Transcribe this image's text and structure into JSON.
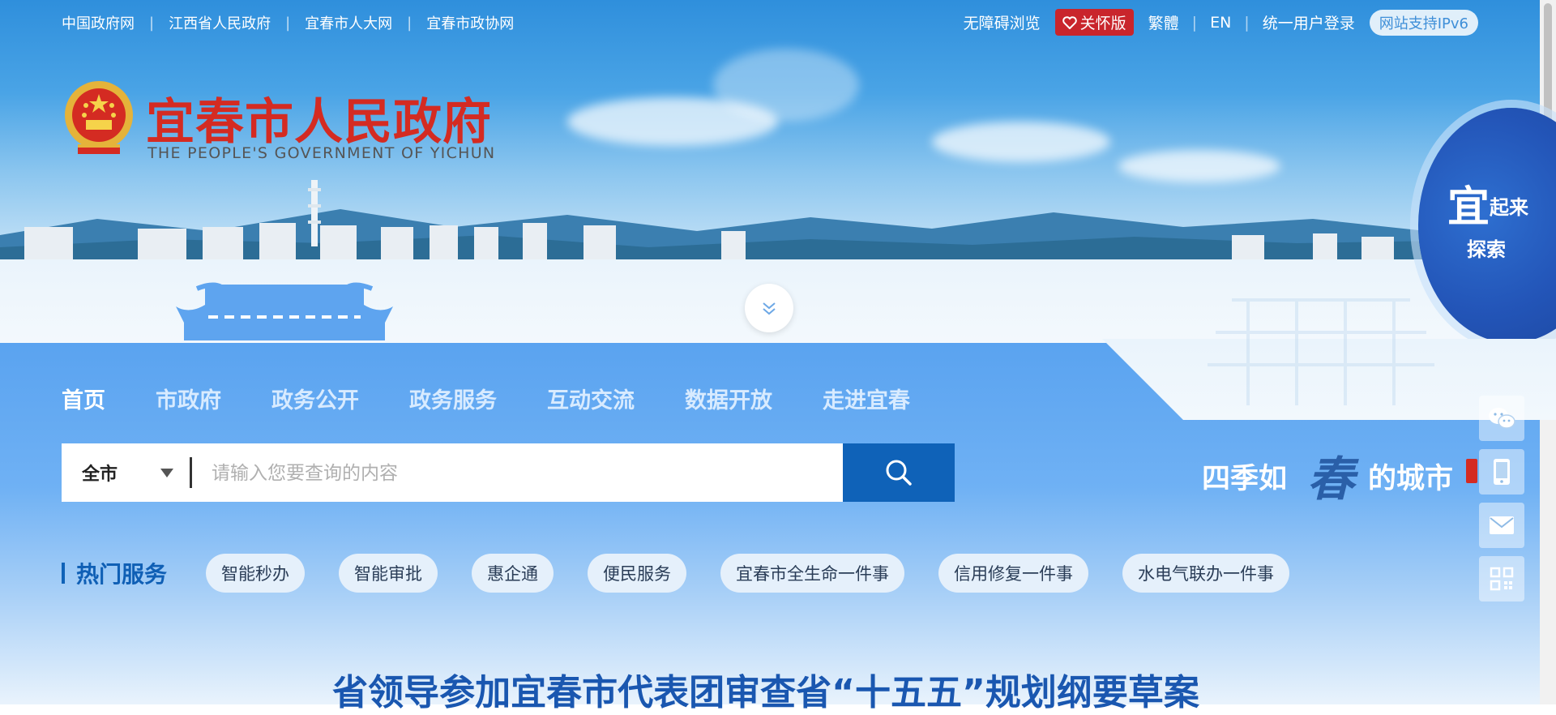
{
  "top_links": [
    "中国政府网",
    "江西省人民政府",
    "宜春市人大网",
    "宜春市政协网"
  ],
  "top_right": {
    "accessibility": "无障碍浏览",
    "care_mode": "关怀版",
    "traditional": "繁體",
    "english": "EN",
    "login": "统一用户登录",
    "ipv6": "网站支持IPv6"
  },
  "logo": {
    "title_cn": "宜春市人民政府",
    "title_en": "THE PEOPLE'S GOVERNMENT OF YICHUN"
  },
  "explore_badge": {
    "big": "宜",
    "small": "起来",
    "bottom": "探索"
  },
  "nav": [
    "首页",
    "市政府",
    "政务公开",
    "政务服务",
    "互动交流",
    "数据开放",
    "走进宜春"
  ],
  "search": {
    "scope": "全市",
    "placeholder": "请输入您要查询的内容"
  },
  "slogan": {
    "left": "四季如",
    "mid": "春",
    "right": "的城市"
  },
  "side_tools": [
    "wechat-icon",
    "mobile-icon",
    "mail-icon",
    "qrcode-icon"
  ],
  "hot_services": {
    "label": "热门服务",
    "items": [
      "智能秒办",
      "智能审批",
      "惠企通",
      "便民服务",
      "宜春市全生命一件事",
      "信用修复一件事",
      "水电气联办一件事"
    ]
  },
  "headline": "省领导参加宜春市代表团审查省“十五五”规划纲要草案",
  "colors": {
    "accent_blue": "#0f62b8",
    "brand_red": "#d42b22",
    "care_red": "#c9252c"
  }
}
